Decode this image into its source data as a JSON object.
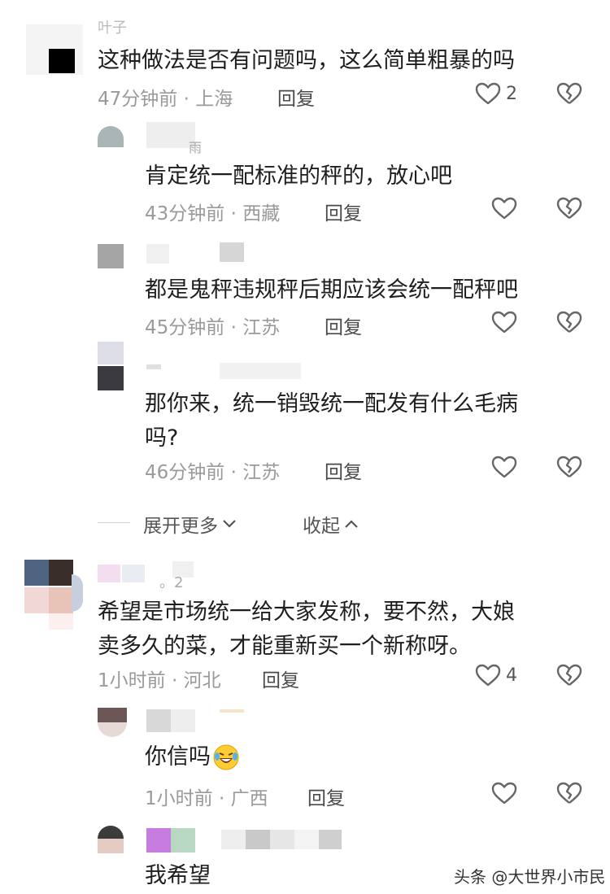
{
  "comments": [
    {
      "text": "这种做法是否有问题吗，这么简单粗暴的吗",
      "time": "47分钟前",
      "sep": "·",
      "location": "上海",
      "reply": "回复",
      "likes": "2",
      "name_fragment": "叶子"
    },
    {
      "text": "肯定统一配标准的秤的，放心吧",
      "time": "43分钟前",
      "sep": "·",
      "location": "西藏",
      "reply": "回复",
      "name_fragment": "雨"
    },
    {
      "text": "都是鬼秤违规秤后期应该会统一配秤吧",
      "time": "45分钟前",
      "sep": "·",
      "location": "江苏",
      "reply": "回复"
    },
    {
      "text_line1": "那你来，统一销毁统一配发有什么毛病",
      "text_line2": "吗?",
      "time": "46分钟前",
      "sep": "·",
      "location": "江苏",
      "reply": "回复"
    },
    {
      "text_line1": "希望是市场统一给大家发称，要不然，大娘",
      "text_line2": "卖多久的菜，才能重新买一个新称呀。",
      "time": "1小时前",
      "sep": "·",
      "location": "河北",
      "reply": "回复",
      "likes": "4",
      "name_fragment": "。2"
    },
    {
      "text": "你信吗",
      "time": "1小时前",
      "sep": "·",
      "location": "广西",
      "reply": "回复"
    },
    {
      "text": "我希望"
    }
  ],
  "expand": {
    "more": "展开更多",
    "collapse": "收起"
  },
  "watermark": "头条 @大世界小市民",
  "icons": {
    "like": "heart-outline-icon",
    "dislike": "broken-heart-icon",
    "expand": "chevron-down-icon",
    "collapse": "chevron-up-icon",
    "emoji": "laughing-crying-emoji-icon"
  },
  "colors": {
    "text": "#1e1e1e",
    "meta": "#9a9a9a",
    "icon": "#666666"
  }
}
